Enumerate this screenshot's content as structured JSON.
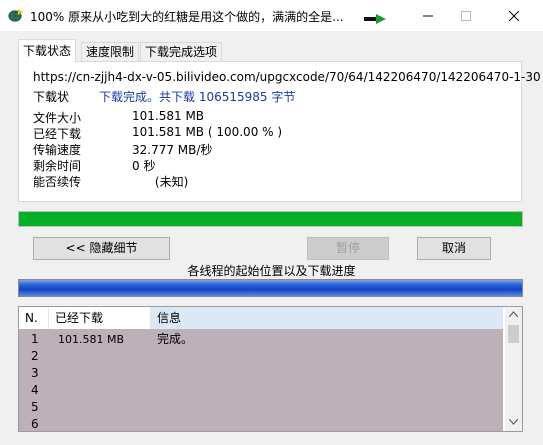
{
  "window": {
    "title": "100% 原来从小吃到大的红糖是用这个做的，满满的全是..."
  },
  "tabs": [
    "下载状态",
    "速度限制",
    "下载完成选项"
  ],
  "status": {
    "url": "https://cn-zjjh4-dx-v-05.bilivideo.com/upgcxcode/70/64/142206470/142206470-1-30",
    "label": "下载状",
    "value": "下载完成。共下载 106515985 字节",
    "rows": [
      {
        "label": "文件大小",
        "value": "101.581  MB"
      },
      {
        "label": "已经下载",
        "value": "101.581  MB  ( 100.00 % )"
      },
      {
        "label": "传输速度",
        "value": "32.777  MB/秒"
      },
      {
        "label": "剩余时间",
        "value": "0 秒"
      },
      {
        "label": "能否续传",
        "value": "      (未知)"
      }
    ]
  },
  "progress": {
    "value": 1.0
  },
  "buttons": {
    "hide_details": "<< 隐藏细节",
    "pause": "暂停",
    "cancel": "取消"
  },
  "threads": {
    "caption": "各线程的起始位置以及下载进度",
    "columns": [
      "N.",
      "已经下载",
      "信息"
    ],
    "rows": [
      {
        "n": "1",
        "downloaded": "101.581 MB",
        "info": "完成。"
      },
      {
        "n": "2",
        "downloaded": "",
        "info": ""
      },
      {
        "n": "3",
        "downloaded": "",
        "info": ""
      },
      {
        "n": "4",
        "downloaded": "",
        "info": ""
      },
      {
        "n": "5",
        "downloaded": "",
        "info": ""
      },
      {
        "n": "6",
        "downloaded": "",
        "info": ""
      }
    ]
  },
  "colors": {
    "accent": "#1a3aa6",
    "progress": "#06b025",
    "thread_bar": "#1244c7",
    "table_rows": "#bdb0b9"
  },
  "icons": [
    "app-globe-icon",
    "green-arrow-icon",
    "minimize-icon",
    "maximize-icon",
    "close-icon",
    "scroll-up-icon",
    "scroll-down-icon"
  ]
}
